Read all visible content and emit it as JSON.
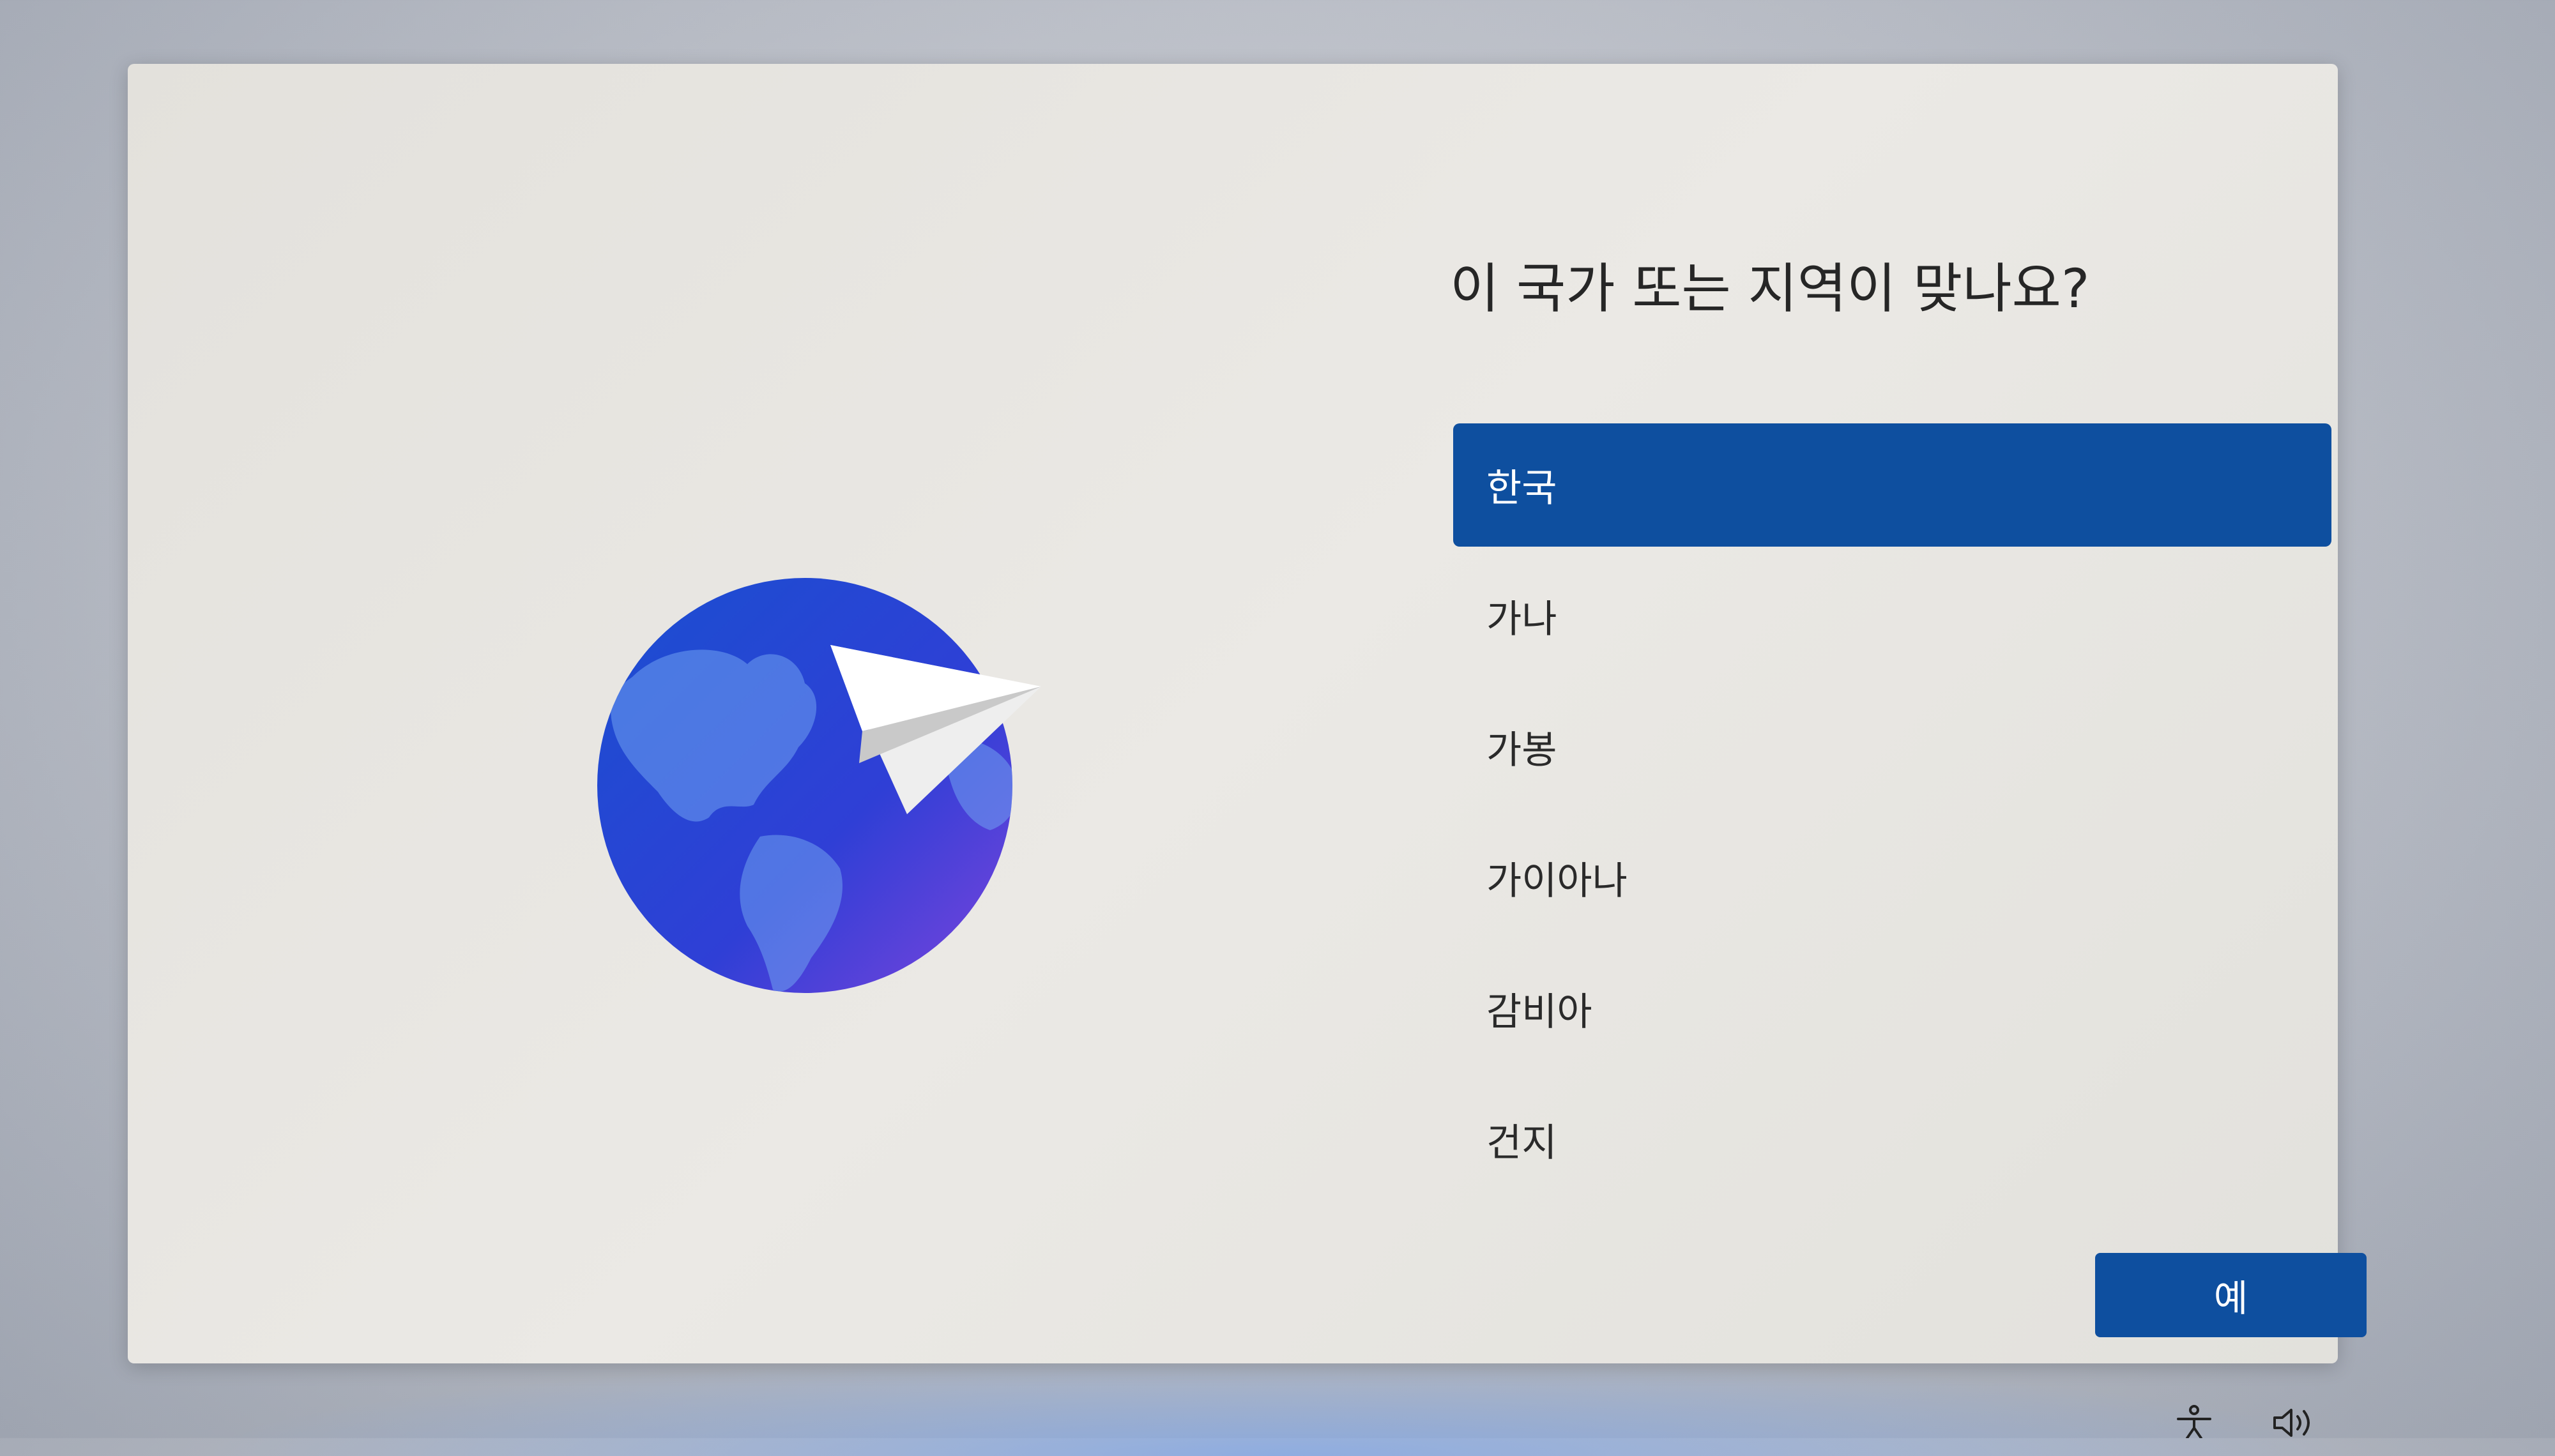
{
  "dialog": {
    "title": "이 국가 또는 지역이 맞나요?",
    "regions": [
      {
        "label": "한국",
        "selected": true
      },
      {
        "label": "가나",
        "selected": false
      },
      {
        "label": "가봉",
        "selected": false
      },
      {
        "label": "가이아나",
        "selected": false
      },
      {
        "label": "감비아",
        "selected": false
      },
      {
        "label": "건지",
        "selected": false
      }
    ],
    "confirm_label": "예"
  },
  "illustration": {
    "icon": "globe-with-paper-plane-icon"
  },
  "tray": {
    "icons": [
      "accessibility-icon",
      "volume-icon"
    ]
  },
  "colors": {
    "accent": "#0e4f9f",
    "panel": "#e8e6e1",
    "globe_dark": "#1744c8",
    "globe_light": "#7a4fe0"
  }
}
